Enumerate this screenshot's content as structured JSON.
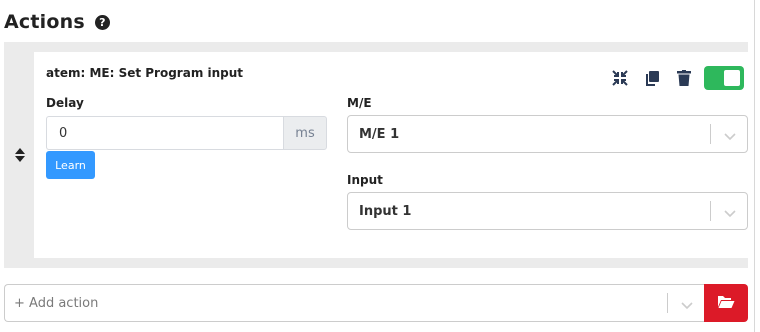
{
  "header": {
    "title": "Actions",
    "help_icon": "question-circle-icon"
  },
  "action": {
    "name": "atem: ME: Set Program input",
    "toolbar": {
      "collapse_icon": "compress-icon",
      "duplicate_icon": "copy-icon",
      "delete_icon": "trash-icon",
      "enabled": true
    },
    "delay": {
      "label": "Delay",
      "value": "0",
      "unit": "ms",
      "learn_label": "Learn"
    },
    "me": {
      "label": "M/E",
      "value": "M/E 1"
    },
    "input": {
      "label": "Input",
      "value": "Input 1"
    }
  },
  "add_action": {
    "placeholder": "+ Add action",
    "folder_icon": "folder-open-icon"
  },
  "colors": {
    "toggle_on": "#2eb85c",
    "learn_button": "#3399ff",
    "folder_button": "#dc1a28",
    "panel_bg": "#ebebeb"
  }
}
